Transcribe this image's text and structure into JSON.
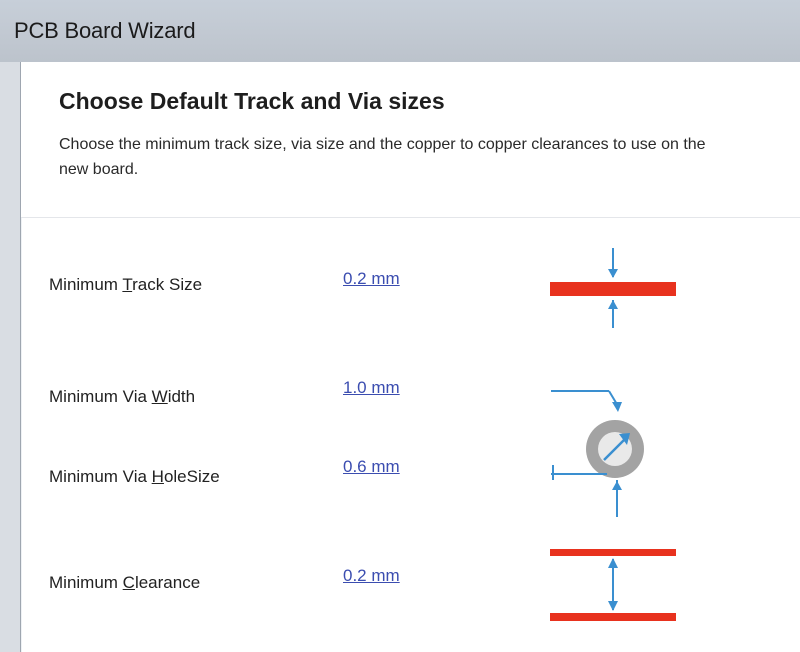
{
  "window": {
    "title": "PCB Board Wizard"
  },
  "header": {
    "title": "Choose Default Track and Via sizes",
    "description": "Choose the minimum track size, via size and the copper to copper clearances to use on the new board."
  },
  "fields": {
    "track_size": {
      "label_prefix": "Minimum ",
      "label_access": "T",
      "label_suffix": "rack Size",
      "value": "0.2 mm"
    },
    "via_width": {
      "label_prefix": "Minimum Via ",
      "label_access": "W",
      "label_suffix": "idth",
      "value": "1.0 mm"
    },
    "via_hole": {
      "label_prefix": "Minimum Via ",
      "label_access": "H",
      "label_suffix": "oleSize",
      "value": "0.6 mm"
    },
    "clearance": {
      "label_prefix": "Minimum ",
      "label_access": "C",
      "label_suffix": "learance",
      "value": "0.2 mm"
    }
  },
  "colors": {
    "copper": "#e8321e",
    "dimension": "#3a8fd0",
    "via_ring": "#a3a3a3",
    "link": "#3b4db0"
  }
}
